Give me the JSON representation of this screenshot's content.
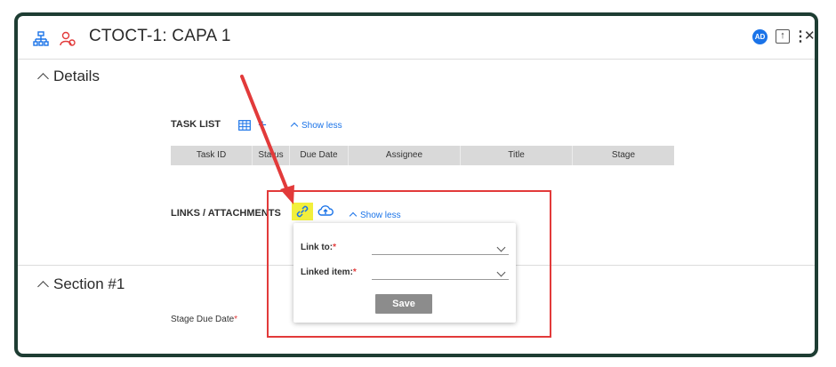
{
  "header": {
    "title": "CTOCT-1: CAPA 1",
    "avatar_initials": "AD"
  },
  "details": {
    "heading": "Details",
    "task_list_label": "TASK LIST",
    "task_show_less": "Show less",
    "columns": [
      "Task ID",
      "Status",
      "Due Date",
      "Assignee",
      "Title",
      "Stage"
    ],
    "links_label": "LINKS / ATTACHMENTS",
    "links_show_less": "Show less"
  },
  "popup": {
    "link_to_label": "Link to:",
    "linked_item_label": "Linked item:",
    "required_mark": "*",
    "save_label": "Save"
  },
  "section1": {
    "heading": "Section #1",
    "stage_due_date_label": "Stage Due Date",
    "required_mark": "*"
  },
  "colors": {
    "accent": "#1a73e8",
    "annotation": "#e23a3a",
    "highlight": "#f2ef3c",
    "frame": "#1e3d33"
  },
  "icons": [
    "hierarchy-icon",
    "users-icon",
    "table-icon",
    "plus-icon",
    "link-icon",
    "cloud-upload-icon",
    "upload-icon",
    "more-icon",
    "close-icon"
  ]
}
